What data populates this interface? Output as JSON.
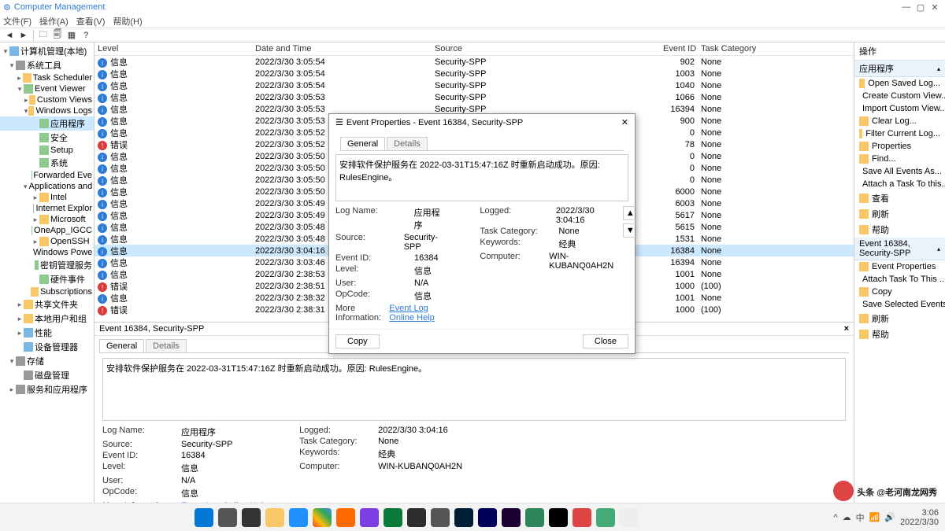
{
  "window": {
    "title": "Computer Management"
  },
  "menu": {
    "file": "文件(F)",
    "action": "操作(A)",
    "view": "查看(V)",
    "help": "帮助(H)"
  },
  "tree": {
    "root": "计算机管理(本地)",
    "system_tools": "系统工具",
    "task_scheduler": "Task Scheduler",
    "event_viewer": "Event Viewer",
    "custom_views": "Custom Views",
    "windows_logs": "Windows Logs",
    "app": "应用程序",
    "security": "安全",
    "setup": "Setup",
    "system": "系统",
    "forwarded": "Forwarded Eve",
    "apps_services": "Applications and S",
    "intel": "Intel",
    "ie": "Internet Explor",
    "microsoft": "Microsoft",
    "oneapp": "OneApp_IGCC",
    "openssh": "OpenSSH",
    "winpowe": "Windows Powe",
    "keymgmt": "密钥管理服务",
    "hardware": "硬件事件",
    "subscriptions": "Subscriptions",
    "shared": "共享文件夹",
    "localusers": "本地用户和组",
    "perf": "性能",
    "devmgr": "设备管理器",
    "storage": "存储",
    "diskmgr": "磁盘管理",
    "services": "服务和应用程序"
  },
  "grid": {
    "cols": {
      "level": "Level",
      "date": "Date and Time",
      "source": "Source",
      "id": "Event ID",
      "task": "Task Category"
    },
    "rows": [
      {
        "level": "信息",
        "date": "2022/3/30 3:05:54",
        "source": "Security-SPP",
        "id": "902",
        "task": "None",
        "icon": "info"
      },
      {
        "level": "信息",
        "date": "2022/3/30 3:05:54",
        "source": "Security-SPP",
        "id": "1003",
        "task": "None",
        "icon": "info"
      },
      {
        "level": "信息",
        "date": "2022/3/30 3:05:54",
        "source": "Security-SPP",
        "id": "1040",
        "task": "None",
        "icon": "info"
      },
      {
        "level": "信息",
        "date": "2022/3/30 3:05:53",
        "source": "Security-SPP",
        "id": "1066",
        "task": "None",
        "icon": "info"
      },
      {
        "level": "信息",
        "date": "2022/3/30 3:05:53",
        "source": "Security-SPP",
        "id": "16394",
        "task": "None",
        "icon": "info"
      },
      {
        "level": "信息",
        "date": "2022/3/30 3:05:53",
        "source": "Security-SPP",
        "id": "900",
        "task": "None",
        "icon": "info"
      },
      {
        "level": "信息",
        "date": "2022/3/30 3:05:52",
        "source": "",
        "id": "0",
        "task": "None",
        "icon": "info"
      },
      {
        "level": "错误",
        "date": "2022/3/30 3:05:52",
        "source": "",
        "id": "78",
        "task": "None",
        "icon": "error"
      },
      {
        "level": "信息",
        "date": "2022/3/30 3:05:50",
        "source": "",
        "id": "0",
        "task": "None",
        "icon": "info"
      },
      {
        "level": "信息",
        "date": "2022/3/30 3:05:50",
        "source": "",
        "id": "0",
        "task": "None",
        "icon": "info"
      },
      {
        "level": "信息",
        "date": "2022/3/30 3:05:50",
        "source": "",
        "id": "0",
        "task": "None",
        "icon": "info"
      },
      {
        "level": "信息",
        "date": "2022/3/30 3:05:50",
        "source": "",
        "id": "6000",
        "task": "None",
        "icon": "info"
      },
      {
        "level": "信息",
        "date": "2022/3/30 3:05:49",
        "source": "",
        "id": "6003",
        "task": "None",
        "icon": "info"
      },
      {
        "level": "信息",
        "date": "2022/3/30 3:05:49",
        "source": "",
        "id": "5617",
        "task": "None",
        "icon": "info"
      },
      {
        "level": "信息",
        "date": "2022/3/30 3:05:48",
        "source": "",
        "id": "5615",
        "task": "None",
        "icon": "info"
      },
      {
        "level": "信息",
        "date": "2022/3/30 3:05:48",
        "source": "",
        "id": "1531",
        "task": "None",
        "icon": "info"
      },
      {
        "level": "信息",
        "date": "2022/3/30 3:04:16",
        "source": "",
        "id": "16384",
        "task": "None",
        "icon": "info",
        "sel": true
      },
      {
        "level": "信息",
        "date": "2022/3/30 3:03:46",
        "source": "",
        "id": "16394",
        "task": "None",
        "icon": "info"
      },
      {
        "level": "信息",
        "date": "2022/3/30 2:38:53",
        "source": "",
        "id": "1001",
        "task": "None",
        "icon": "info"
      },
      {
        "level": "错误",
        "date": "2022/3/30 2:38:51",
        "source": "",
        "id": "1000",
        "task": "(100)",
        "icon": "error"
      },
      {
        "level": "信息",
        "date": "2022/3/30 2:38:32",
        "source": "",
        "id": "1001",
        "task": "None",
        "icon": "info"
      },
      {
        "level": "错误",
        "date": "2022/3/30 2:38:31",
        "source": "",
        "id": "1000",
        "task": "(100)",
        "icon": "error"
      }
    ]
  },
  "detail": {
    "title": "Event 16384, Security-SPP",
    "tab_general": "General",
    "tab_details": "Details",
    "message": "安排软件保护服务在 2022-03-31T15:47:16Z 时重新启动成功。原因: RulesEngine。",
    "labels": {
      "logname": "Log Name:",
      "source": "Source:",
      "eventid": "Event ID:",
      "level": "Level:",
      "user": "User:",
      "opcode": "OpCode:",
      "moreinfo": "More Information:",
      "logged": "Logged:",
      "taskcat": "Task Category:",
      "keywords": "Keywords:",
      "computer": "Computer:"
    },
    "values": {
      "logname": "应用程序",
      "source": "Security-SPP",
      "eventid": "16384",
      "level": "信息",
      "user": "N/A",
      "opcode": "信息",
      "moreinfo": "Event Log Online Help",
      "logged": "2022/3/30 3:04:16",
      "taskcat": "None",
      "keywords": "经典",
      "computer": "WIN-KUBANQ0AH2N"
    }
  },
  "dialog": {
    "title": "Event Properties - Event 16384, Security-SPP",
    "copy": "Copy",
    "close": "Close"
  },
  "actions": {
    "header": "操作",
    "group1": "应用程序",
    "items1": [
      "Open Saved Log...",
      "Create Custom View...",
      "Import Custom View...",
      "Clear Log...",
      "Filter Current Log...",
      "Properties",
      "Find...",
      "Save All Events As...",
      "Attach a Task To this...",
      "查看",
      "刷新",
      "帮助"
    ],
    "group2": "Event 16384, Security-SPP",
    "items2": [
      "Event Properties",
      "Attach Task To This ...",
      "Copy",
      "Save Selected Events...",
      "刷新",
      "帮助"
    ]
  },
  "taskbar": {
    "time": "3:06",
    "date": "2022/3/30"
  },
  "watermark": "头条 @老河南龙网秀"
}
